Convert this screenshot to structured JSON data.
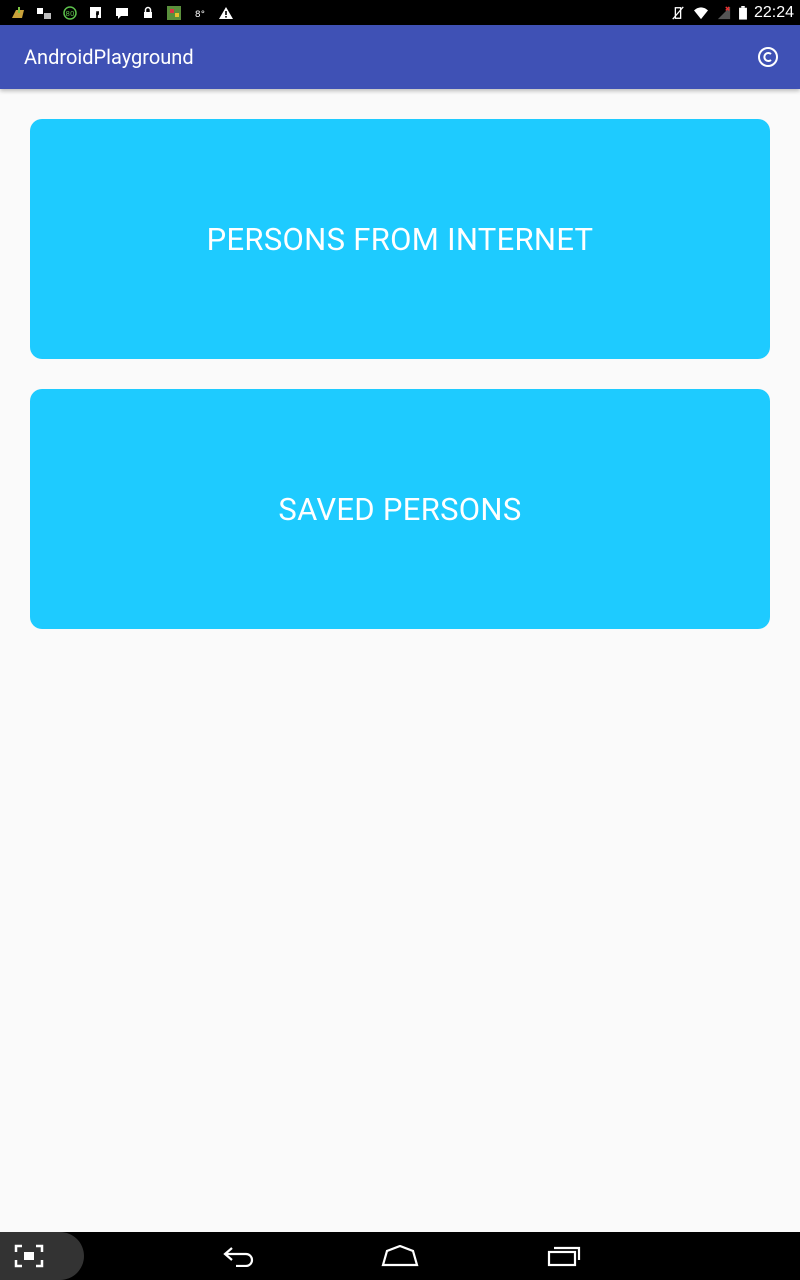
{
  "status_bar": {
    "time": "22:24",
    "left_icons": [
      "download-icon",
      "app-icon",
      "badge-80-icon",
      "facebook-icon",
      "message-icon",
      "lock-icon",
      "image-icon",
      "temperature-icon",
      "warning-icon"
    ],
    "right_icons": [
      "vibrate-off-icon",
      "wifi-icon",
      "no-signal-icon",
      "battery-icon"
    ]
  },
  "app_bar": {
    "title": "AndroidPlayground",
    "action_icon": "copyright-icon",
    "color": "#3f51b5"
  },
  "buttons": {
    "internet_label": "PERSONS FROM INTERNET",
    "saved_label": "SAVED PERSONS",
    "color": "#1ecbff"
  },
  "nav_bar": {
    "icons": [
      "screenshot-icon",
      "back-icon",
      "home-icon",
      "recents-icon"
    ]
  }
}
